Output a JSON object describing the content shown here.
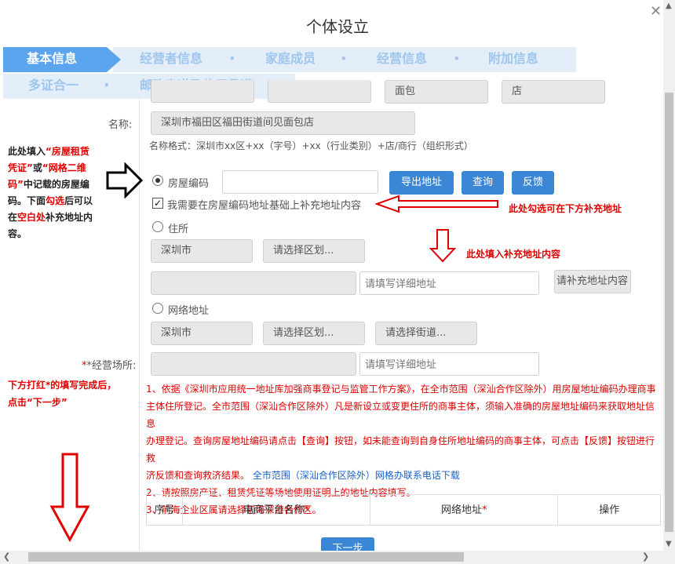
{
  "window": {
    "title": "个体设立"
  },
  "steps": [
    "基本信息",
    "经营者信息",
    "家庭成员",
    "经营信息",
    "附加信息",
    "多证合一",
    "邮政寄递及信用承诺"
  ],
  "name_parts": [
    "",
    "",
    "面包",
    "店"
  ],
  "name_label": "名称:",
  "name_value": "深圳市福田区福田街道间见面包店",
  "name_format": "名称格式：深圳市xx区+xx（字号）+xx（行业类别）+店/商行（组织形式）",
  "left_note_1": [
    "此处填入“房屋租赁",
    "凭证”或“网格二维",
    "码”中记载的房屋编",
    "码。下面勾选后可以",
    "在空白处补充地址内",
    "容。"
  ],
  "left_note_2": [
    "下方打红*的填写完成后，",
    "点击“下一步”"
  ],
  "house_code_label": "房屋编码",
  "house_code_value": "",
  "buttons": {
    "export": "导出地址",
    "query": "查询",
    "feedback": "反馈",
    "next": "下一步"
  },
  "supplement_check": "我需要在房屋编码地址基础上补充地址内容",
  "annot_check": "此处勾选可在下方补充地址",
  "annot_fill": "此处填入补充地址内容",
  "residence_label": "住所",
  "residence": {
    "city": "深圳市",
    "district": "请选择区划...",
    "detail_placeholder": "请填写详细地址",
    "supplement_placeholder": "请补充地址内容"
  },
  "network_label": "网络地址",
  "network": {
    "city": "深圳市",
    "district": "请选择区划...",
    "street": "请选择街道..."
  },
  "business_place_label": "*经营场所:",
  "business_detail_placeholder": "请填写详细地址",
  "info_1a": "1、依据《深圳市应用统一地址库加强商事登记与监管工作方案》，在全市范围（深汕合作区除外）用房屋地址编码办理商事",
  "info_1b": "主体住所登记。全市范围（深汕合作区除外）凡是新设立或变更住所的商事主体，须输入准确的房屋地址编码来获取地址信息",
  "info_1c": "办理登记。查询房屋地址编码请点击【查询】按钮，如未能查询到自身住所地址编码的商事主体，可点击【反馈】按钮进行救",
  "info_1d": "济反馈和查询救济结果。",
  "info_1_link": "全市范围（深汕合作区除外）网格办联系电话下载",
  "info_2": "2、请按照房产证、租赁凭证等场地使用证明上的地址内容填写。",
  "info_3": "3、前海企业区属请选择前海深港合作区。",
  "table_headers": {
    "no": "序号",
    "platform": "电商平台名称",
    "addr": "网络地址",
    "op": "操作"
  },
  "colors": {
    "accent": "#3c86d6",
    "annotation": "#e00000",
    "step_active": "#5ba4ee"
  }
}
